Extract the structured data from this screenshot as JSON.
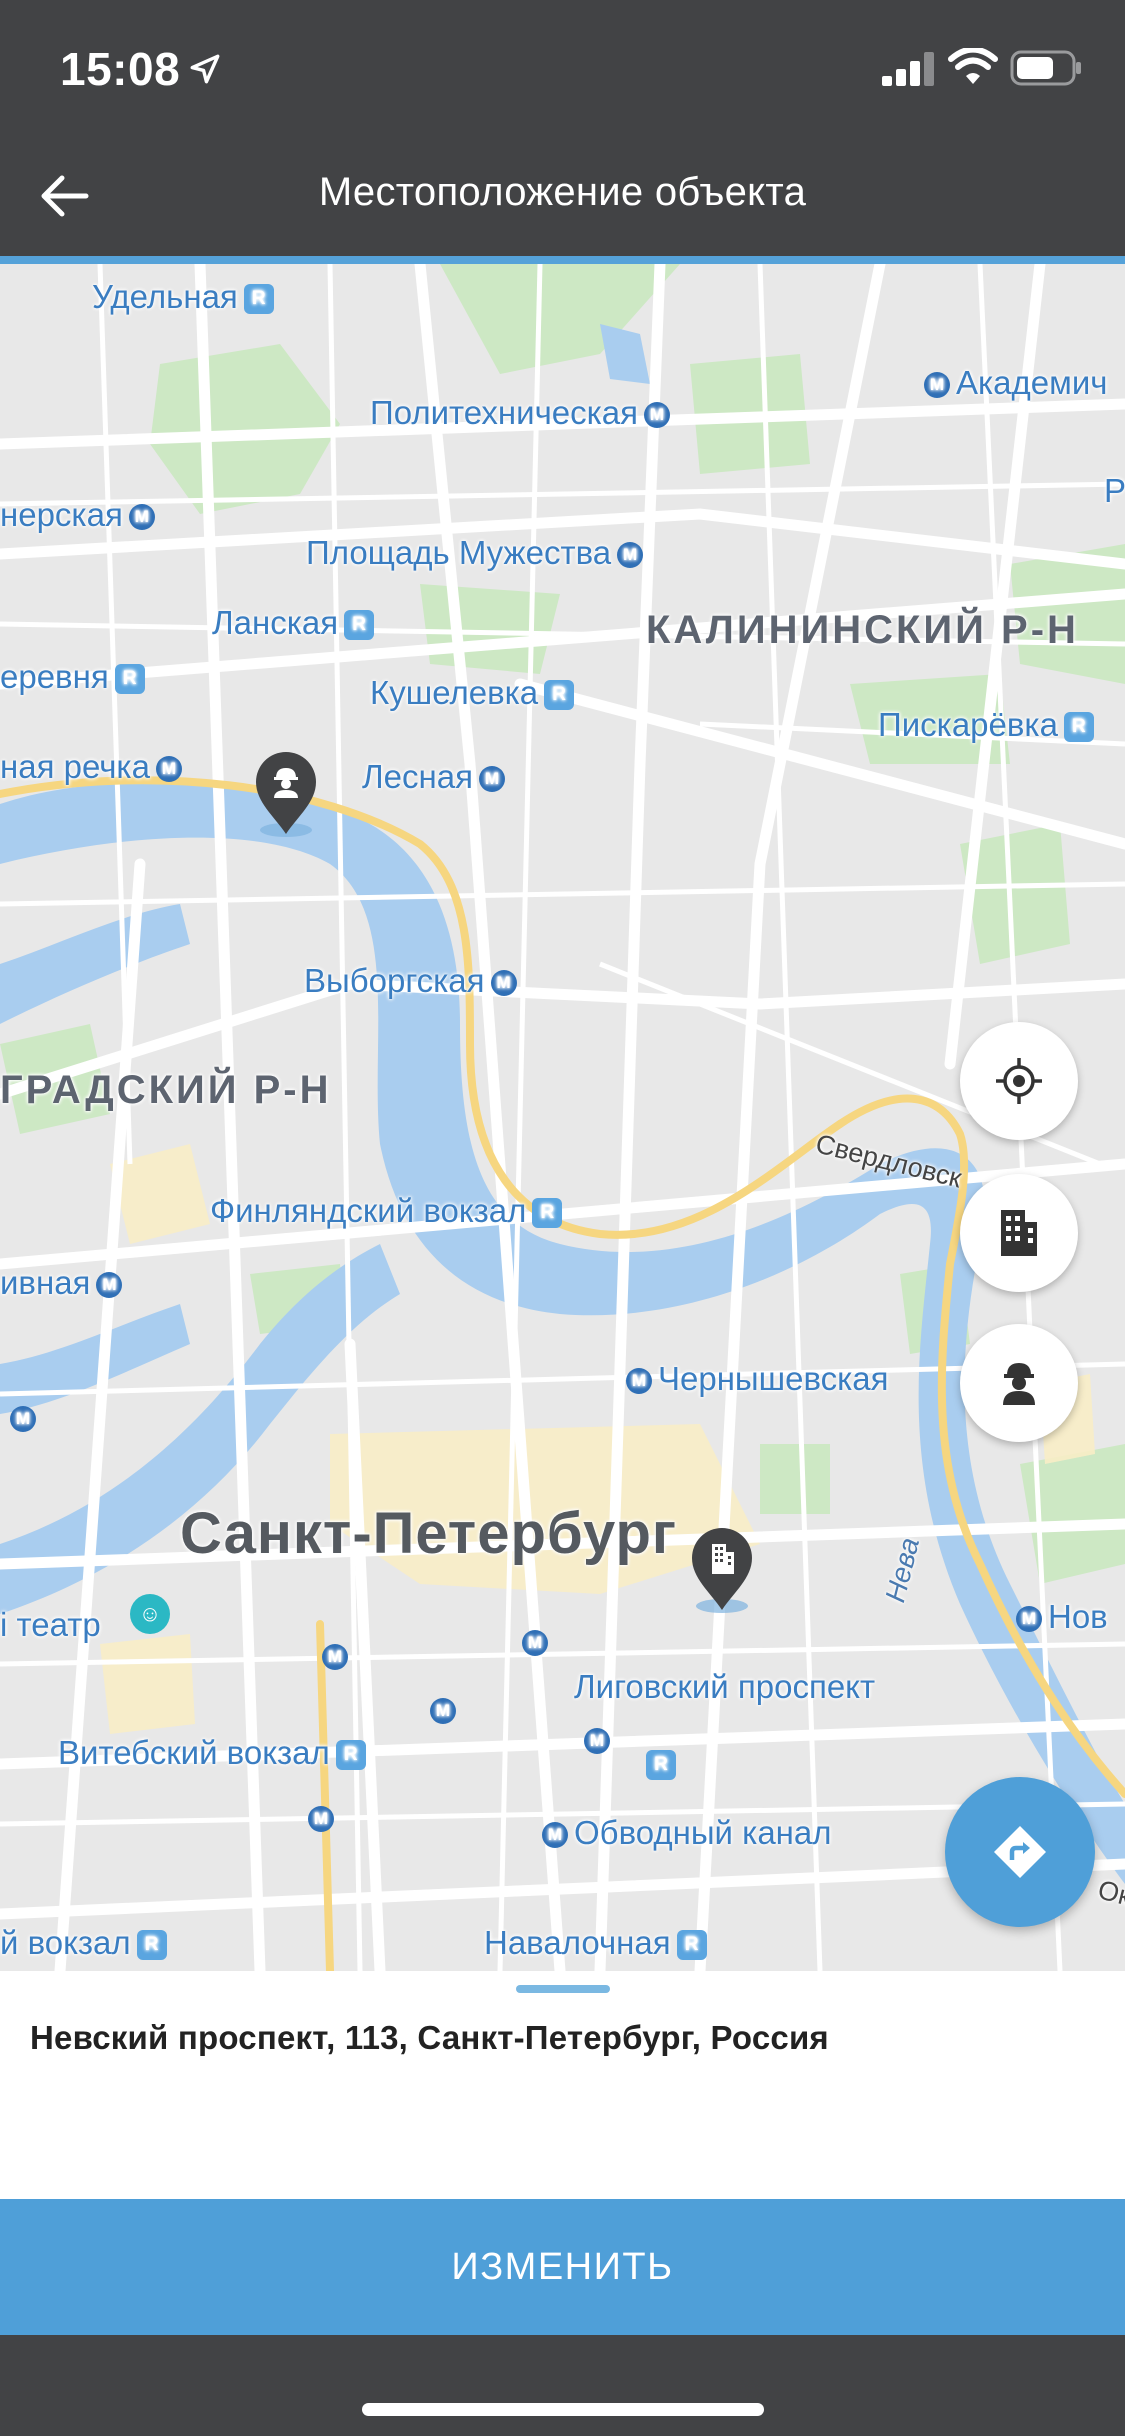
{
  "status_bar": {
    "time": "15:08"
  },
  "header": {
    "title": "Местоположение объекта"
  },
  "map": {
    "labels": {
      "udelnaya": "Удельная",
      "akademicheskaya": "Академич",
      "politekhnicheskaya": "Политехническая",
      "chernaya": "нерская",
      "ploshchad": "Площадь Мужества",
      "r_edge": "Р",
      "lanskaya": "Ланская",
      "kalininsky": "КАЛИНИНСКИЙ Р-Н",
      "derevnya": "еревня",
      "kushelevka": "Кушелевка",
      "piskarevka": "Пискарёвка",
      "rechka": "ная речка",
      "lesnaya": "Лесная",
      "vyborgskaya": "Выборгская",
      "gradsky": "ГРАДСКИЙ Р-Н",
      "sverdlovskaya": "Свердловск",
      "finlyandsky": "Финляндский вокзал",
      "vnaya": "ивная",
      "chernyshevskaya": "Чернышевская",
      "spb": "Санкт-Петербург",
      "neva": "Нева",
      "teatr": "і театр",
      "novo": "Нов",
      "ligovsky": "Лиговский проспект",
      "vitebsky": "Витебский вокзал",
      "obvodny": "Обводный канал",
      "ok": "Ок",
      "vokzal": "й вокзал",
      "navalochnaya": "Навалочная"
    },
    "markers": [
      {
        "type": "worker",
        "icon": "worker-icon"
      },
      {
        "type": "building",
        "icon": "building-icon"
      }
    ],
    "controls": {
      "my_location": "crosshair-icon",
      "objects": "building-icon",
      "workers": "worker-icon",
      "route": "directions-icon"
    }
  },
  "sheet": {
    "address": "Невский проспект, 113, Санкт-Петербург, Россия"
  },
  "actions": {
    "change_label": "ИЗМЕНИТЬ"
  },
  "colors": {
    "bar": "#424345",
    "accent": "#4f9fd8",
    "water": "#a9cdef",
    "map": "#e8e8e8"
  }
}
